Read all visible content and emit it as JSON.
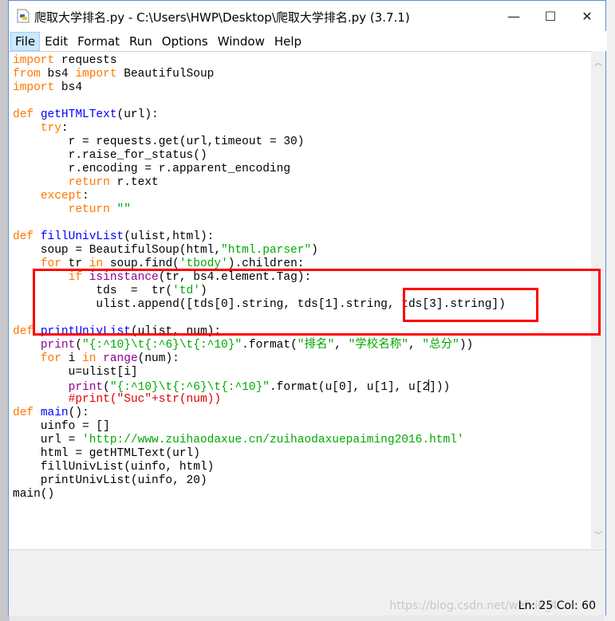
{
  "window": {
    "title": "爬取大学排名.py - C:\\Users\\HWP\\Desktop\\爬取大学排名.py (3.7.1)",
    "controls": {
      "minimize": "—",
      "maximize": "☐",
      "close": "✕"
    }
  },
  "menu": [
    {
      "label": "File",
      "active": true
    },
    {
      "label": "Edit"
    },
    {
      "label": "Format"
    },
    {
      "label": "Run"
    },
    {
      "label": "Options"
    },
    {
      "label": "Window"
    },
    {
      "label": "Help"
    }
  ],
  "colors": {
    "keyword": "#ff7700",
    "definition": "#0000ff",
    "builtin": "#900090",
    "string": "#00aa00",
    "comment": "#dd0000",
    "highlight_box": "#ff0000"
  },
  "code": [
    [
      [
        "import",
        "k"
      ],
      [
        " requests",
        ""
      ]
    ],
    [
      [
        "from",
        "k"
      ],
      [
        " bs4 ",
        ""
      ],
      [
        "import",
        "k"
      ],
      [
        " BeautifulSoup",
        ""
      ]
    ],
    [
      [
        "import",
        "k"
      ],
      [
        " bs4",
        ""
      ]
    ],
    [],
    [
      [
        "def",
        "k"
      ],
      [
        " ",
        ""
      ],
      [
        "getHTMLText",
        "d"
      ],
      [
        "(url):",
        ""
      ]
    ],
    [
      [
        "    ",
        ""
      ],
      [
        "try",
        "k"
      ],
      [
        ":",
        ""
      ]
    ],
    [
      [
        "        r = requests.get(url,timeout = 30)",
        ""
      ]
    ],
    [
      [
        "        r.raise_for_status()",
        ""
      ]
    ],
    [
      [
        "        r.encoding = r.apparent_encoding",
        ""
      ]
    ],
    [
      [
        "        ",
        ""
      ],
      [
        "return",
        "k"
      ],
      [
        " r.text",
        ""
      ]
    ],
    [
      [
        "    ",
        ""
      ],
      [
        "except",
        "k"
      ],
      [
        ":",
        ""
      ]
    ],
    [
      [
        "        ",
        ""
      ],
      [
        "return",
        "k"
      ],
      [
        " ",
        ""
      ],
      [
        "\"\"",
        "s"
      ]
    ],
    [],
    [
      [
        "def",
        "k"
      ],
      [
        " ",
        ""
      ],
      [
        "fillUnivList",
        "d"
      ],
      [
        "(ulist,html):",
        ""
      ]
    ],
    [
      [
        "    soup = BeautifulSoup(html,",
        ""
      ],
      [
        "\"html.parser\"",
        "s"
      ],
      [
        ")",
        ""
      ]
    ],
    [
      [
        "    ",
        ""
      ],
      [
        "for",
        "k"
      ],
      [
        " tr ",
        ""
      ],
      [
        "in",
        "k"
      ],
      [
        " soup.find(",
        ""
      ],
      [
        "'tbody'",
        "s"
      ],
      [
        ").children:",
        ""
      ]
    ],
    [
      [
        "        ",
        ""
      ],
      [
        "if",
        "k"
      ],
      [
        " ",
        ""
      ],
      [
        "isinstance",
        "b"
      ],
      [
        "(tr, bs4.element.Tag):",
        ""
      ]
    ],
    [
      [
        "            tds  =  tr(",
        ""
      ],
      [
        "'td'",
        "s"
      ],
      [
        ")",
        ""
      ]
    ],
    [
      [
        "            ulist.append([tds[0].string, tds[1].string, tds[3].string])",
        ""
      ]
    ],
    [],
    [
      [
        "def",
        "k"
      ],
      [
        " ",
        ""
      ],
      [
        "printUnivList",
        "d"
      ],
      [
        "(ulist, num):",
        ""
      ]
    ],
    [
      [
        "    ",
        ""
      ],
      [
        "print",
        "b"
      ],
      [
        "(",
        ""
      ],
      [
        "\"{:^10}\\t{:^6}\\t{:^10}\"",
        "s"
      ],
      [
        ".format(",
        ""
      ],
      [
        "\"排名\"",
        "s"
      ],
      [
        ", ",
        ""
      ],
      [
        "\"学校名称\"",
        "s"
      ],
      [
        ", ",
        ""
      ],
      [
        "\"总分\"",
        "s"
      ],
      [
        "))",
        ""
      ]
    ],
    [
      [
        "    ",
        ""
      ],
      [
        "for",
        "k"
      ],
      [
        " i ",
        ""
      ],
      [
        "in",
        "k"
      ],
      [
        " ",
        ""
      ],
      [
        "range",
        "b"
      ],
      [
        "(num):",
        ""
      ]
    ],
    [
      [
        "        u=ulist[i]",
        ""
      ]
    ],
    [
      [
        "        ",
        ""
      ],
      [
        "print",
        "b"
      ],
      [
        "(",
        ""
      ],
      [
        "\"{:^10}\\t{:^6}\\t{:^10}\"",
        "s"
      ],
      [
        ".format(u[0], u[1], u[2",
        ""
      ],
      [
        "|",
        "cursor"
      ],
      [
        "]))",
        ""
      ]
    ],
    [
      [
        "        ",
        ""
      ],
      [
        "#print(\"Suc\"+str(num))",
        "c"
      ]
    ],
    [
      [
        "def",
        "k"
      ],
      [
        " ",
        ""
      ],
      [
        "main",
        "d"
      ],
      [
        "():",
        ""
      ]
    ],
    [
      [
        "    uinfo = []",
        ""
      ]
    ],
    [
      [
        "    url = ",
        ""
      ],
      [
        "'http://www.zuihaodaxue.cn/zuihaodaxuepaiming2016.html'",
        "s"
      ]
    ],
    [
      [
        "    html = getHTMLText(url)",
        ""
      ]
    ],
    [
      [
        "    fillUnivList(uinfo, html)",
        ""
      ]
    ],
    [
      [
        "    printUnivList(uinfo, 20)",
        ""
      ]
    ],
    [
      [
        "main()",
        ""
      ]
    ]
  ],
  "status": {
    "position": "Ln: 25  Col: 60",
    "watermark": "https://blog.csdn.net/weixin_4"
  }
}
